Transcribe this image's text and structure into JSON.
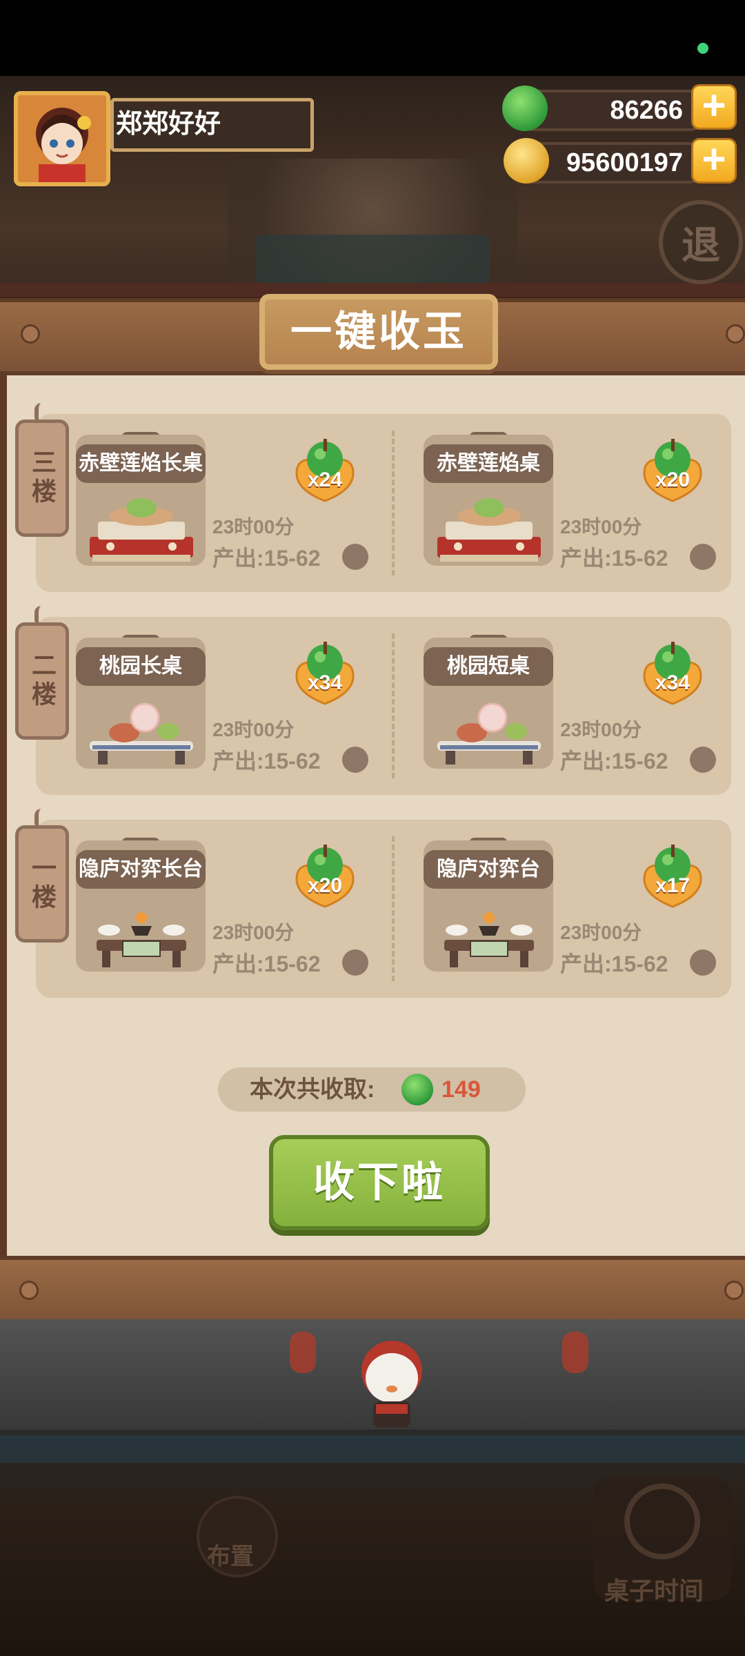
{
  "player": {
    "name": "郑郑好好",
    "avatar_icon": "character-avatar-icon"
  },
  "currency": {
    "jade": {
      "value": "86266",
      "icon": "jade-icon"
    },
    "coins": {
      "value": "95600197",
      "icon": "coin-icon"
    },
    "add_label": "+"
  },
  "exit_label": "退",
  "dialog": {
    "title": "一键收玉",
    "floors": [
      {
        "label": "三楼",
        "tables": [
          {
            "name": "赤壁莲焰长桌",
            "jade_count": "x24",
            "time": "23时00分",
            "output": "产出:15-62",
            "art": "red-lotus-table"
          },
          {
            "name": "赤壁莲焰桌",
            "jade_count": "x20",
            "time": "23时00分",
            "output": "产出:15-62",
            "art": "red-lotus-table"
          }
        ]
      },
      {
        "label": "二楼",
        "tables": [
          {
            "name": "桃园长桌",
            "jade_count": "x34",
            "time": "23时00分",
            "output": "产出:15-62",
            "art": "peach-garden-table"
          },
          {
            "name": "桃园短桌",
            "jade_count": "x34",
            "time": "23时00分",
            "output": "产出:15-62",
            "art": "peach-garden-table"
          }
        ]
      },
      {
        "label": "一楼",
        "tables": [
          {
            "name": "隐庐对弈长台",
            "jade_count": "x20",
            "time": "23时00分",
            "output": "产出:15-62",
            "art": "go-board-table"
          },
          {
            "name": "隐庐对弈台",
            "jade_count": "x17",
            "time": "23时00分",
            "output": "产出:15-62",
            "art": "go-board-table"
          }
        ]
      }
    ],
    "total_label": "本次共收取:",
    "total_value": "149",
    "collect_button": "收下啦"
  },
  "bottom_nav": {
    "layout_label": "布置",
    "table_time_label": "桌子时间"
  },
  "colors": {
    "jade_green": "#3fa845",
    "title_plate": "#c79a61",
    "panel_bg": "#e6d8c3",
    "collect_green": "#8fbd44",
    "total_value": "#d9573a"
  }
}
